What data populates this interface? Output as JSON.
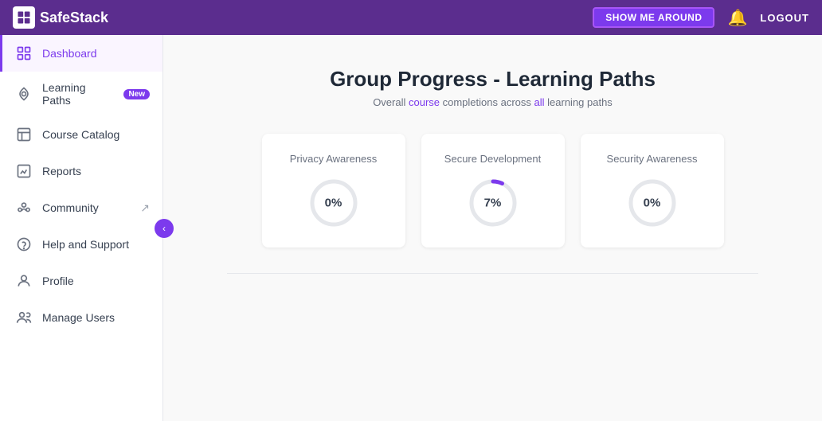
{
  "topnav": {
    "logo_text": "SafeStack",
    "show_me_label": "SHOW ME AROUND",
    "logout_label": "LOGOUT"
  },
  "sidebar": {
    "items": [
      {
        "id": "dashboard",
        "label": "Dashboard",
        "icon": "dashboard-icon",
        "active": true,
        "badge": null,
        "external": false
      },
      {
        "id": "learning-paths",
        "label": "Learning Paths",
        "icon": "learning-paths-icon",
        "active": false,
        "badge": "New",
        "external": false
      },
      {
        "id": "course-catalog",
        "label": "Course Catalog",
        "icon": "course-catalog-icon",
        "active": false,
        "badge": null,
        "external": false
      },
      {
        "id": "reports",
        "label": "Reports",
        "icon": "reports-icon",
        "active": false,
        "badge": null,
        "external": false
      },
      {
        "id": "community",
        "label": "Community",
        "icon": "community-icon",
        "active": false,
        "badge": null,
        "external": true
      },
      {
        "id": "help-support",
        "label": "Help and Support",
        "icon": "help-icon",
        "active": false,
        "badge": null,
        "external": false
      },
      {
        "id": "profile",
        "label": "Profile",
        "icon": "profile-icon",
        "active": false,
        "badge": null,
        "external": false
      },
      {
        "id": "manage-users",
        "label": "Manage Users",
        "icon": "manage-users-icon",
        "active": false,
        "badge": null,
        "external": false
      }
    ],
    "collapse_label": "‹"
  },
  "main": {
    "title": "Group Progress - Learning Paths",
    "subtitle": "Overall course completions across all learning paths",
    "subtitle_highlights": [
      "course",
      "all"
    ],
    "cards": [
      {
        "id": "privacy-awareness",
        "title": "Privacy Awareness",
        "percent": 0,
        "percent_label": "0%"
      },
      {
        "id": "secure-development",
        "title": "Secure Development",
        "percent": 7,
        "percent_label": "7%"
      },
      {
        "id": "security-awareness",
        "title": "Security Awareness",
        "percent": 0,
        "percent_label": "0%"
      }
    ]
  }
}
